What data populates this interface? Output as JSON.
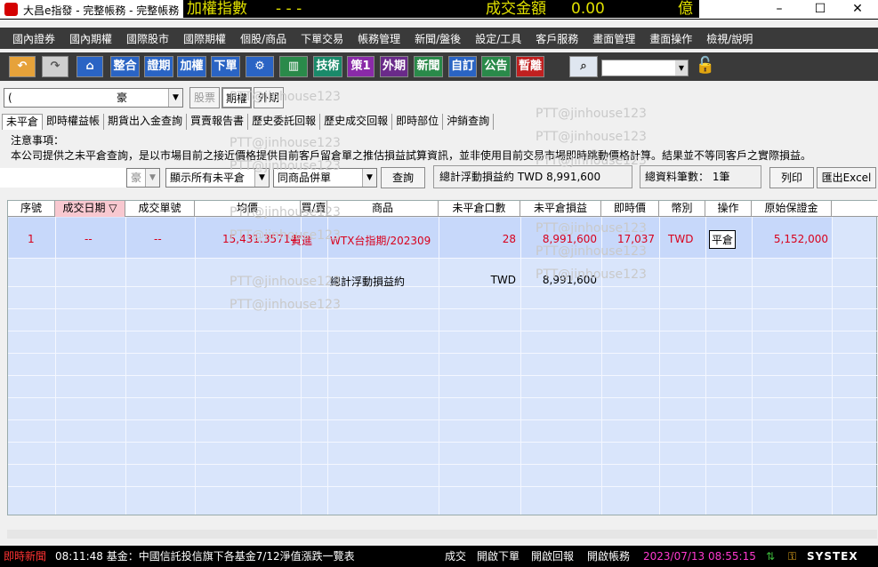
{
  "window": {
    "app_title": "大昌e指發 - 完整帳務 - 完整帳務",
    "ticker_name": "加權指數",
    "ticker_dashes": "- - -",
    "turnover_label": "成交金額",
    "turnover_value": "0.00",
    "turnover_unit": "億",
    "minimize": "–",
    "maximize": "☐",
    "close": "✕"
  },
  "menu": [
    "國內證券",
    "國內期權",
    "國際股市",
    "國際期權",
    "個股/商品",
    "下單交易",
    "帳務管理",
    "新聞/盤後",
    "設定/工具",
    "客戶服務",
    "畫面管理",
    "畫面操作",
    "檢視/說明"
  ],
  "toolbar": {
    "buttons": [
      "整合",
      "證期",
      "加權",
      "下單",
      "技術",
      "策1",
      "外期",
      "新聞",
      "自訂",
      "公告",
      "暫離"
    ]
  },
  "controls": {
    "account_value": "(",
    "account_suffix": "豪",
    "filter_tabs": [
      "股票",
      "期權",
      "外期"
    ],
    "view_select": "顯示所有未平倉",
    "merge_select": "同商品併單",
    "left_combo": "豪",
    "query_button": "查詢",
    "print_button": "列印",
    "export_button": "匯出Excel"
  },
  "tabs": [
    "未平倉",
    "即時權益帳",
    "期貨出入金查詢",
    "買賣報告書",
    "歷史委託回報",
    "歷史成交回報",
    "即時部位",
    "沖銷查詢"
  ],
  "notice": {
    "title": "注意事項：",
    "text": "本公司提供之未平倉查詢，是以市場目前之接近價格提供目前客戶留倉單之推估損益試算資訊，並非使用目前交易市場即時跳動價格計算。結果並不等同客戶之實際損益。"
  },
  "summary": {
    "float_label": "總計浮動損益約",
    "float_value": "TWD 8,991,600",
    "count_label": "總資料筆數：",
    "count_value": "1筆"
  },
  "table": {
    "headers": [
      "序號",
      "成交日期 ▽",
      "成交單號",
      "均價",
      "買/賣",
      "商品",
      "未平倉口數",
      "未平倉損益",
      "即時價",
      "幣別",
      "操作",
      "原始保證金"
    ],
    "row": {
      "seq": "1",
      "date": "--",
      "order_no": "--",
      "avg_price": "15,431.35714",
      "side": "買進",
      "product": "WTX台指期/202309",
      "qty": "28",
      "pnl": "8,991,600",
      "last_price": "17,037",
      "currency": "TWD",
      "action": "平倉",
      "margin": "5,152,000"
    },
    "total": {
      "label": "總計浮動損益約",
      "currency": "TWD",
      "value": "8,991,600"
    }
  },
  "watermark": "PTT@jinhouse123",
  "statusbar": {
    "news_label": "即時新聞",
    "news_text": "08:11:48 基金：中國信託投信旗下各基金7/12淨值漲跌一覽表",
    "links": [
      "成交",
      "開啟下單",
      "開啟回報",
      "開啟帳務"
    ],
    "datetime": "2023/07/13 08:55:15",
    "brand": "SYSTEX"
  }
}
